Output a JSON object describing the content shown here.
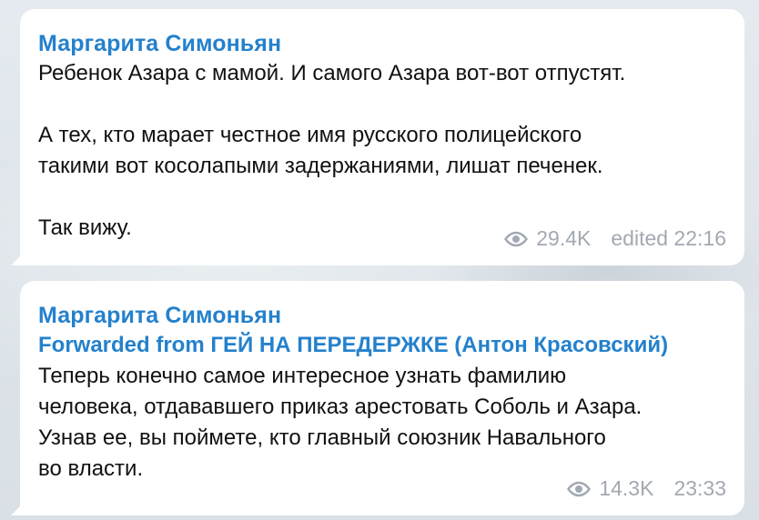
{
  "messages": [
    {
      "sender": "Маргарита Симоньян",
      "forwarded_from": "",
      "lines": [
        "Ребенок Азара с мамой. И самого Азара вот-вот отпустят.",
        "",
        "А тех, кто марает честное имя русского полицейского",
        "такими вот косолапыми задержаниями, лишат печенек.",
        "",
        "Так вижу."
      ],
      "views": "29.4K",
      "time": "edited 22:16",
      "eye_icon": "eye-icon"
    },
    {
      "sender": "Маргарита Симоньян",
      "forwarded_from": "Forwarded from ГЕЙ НА ПЕРЕДЕРЖКЕ (Антон Красовский)",
      "lines": [
        "Теперь конечно самое интересное узнать фамилию",
        "человека, отдававшего приказ арестовать Соболь и Азара.",
        "Узнав ее, вы поймете, кто главный союзник Навального",
        "во власти."
      ],
      "views": "14.3K",
      "time": "23:33",
      "eye_icon": "eye-icon"
    }
  ],
  "colors": {
    "accent": "#2481cc",
    "meta": "#a2a9b2",
    "text": "#111111",
    "bubble": "#ffffff",
    "background": "#dfe6ec"
  }
}
